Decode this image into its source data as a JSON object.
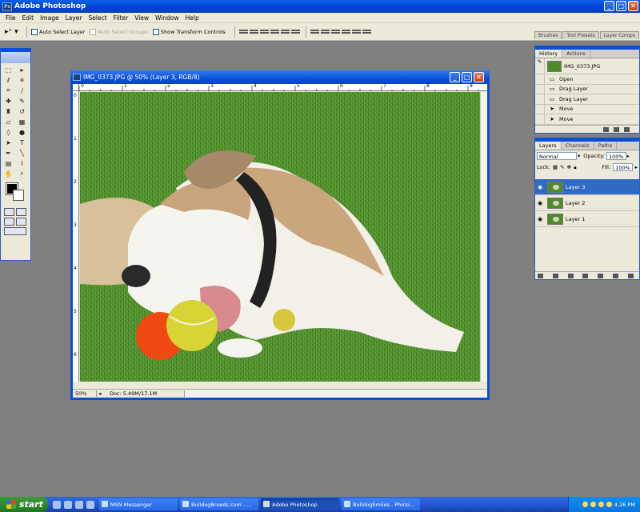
{
  "app": {
    "title": "Adobe Photoshop",
    "logo": "Ps",
    "min": "_",
    "max": "□",
    "close": "✕"
  },
  "menu": [
    "File",
    "Edit",
    "Image",
    "Layer",
    "Select",
    "Filter",
    "View",
    "Window",
    "Help"
  ],
  "options": {
    "auto_select_layer": "Auto Select Layer",
    "auto_select_groups": "Auto Select Groups",
    "show_transform_controls": "Show Transform Controls"
  },
  "palette_well": [
    "Brushes",
    "Tool Presets",
    "Layer Comps"
  ],
  "document": {
    "title": "IMG_0373.JPG @ 50% (Layer 3, RGB/8)",
    "zoom": "50%",
    "doc_info": "Doc: 5.49M/17.1M",
    "ruler_top": [
      "0",
      "1",
      "2",
      "3",
      "4",
      "5",
      "6",
      "7",
      "8",
      "9"
    ],
    "ruler_left": [
      "0",
      "1",
      "2",
      "3",
      "4",
      "5",
      "6"
    ]
  },
  "history": {
    "tabs": [
      "History",
      "Actions"
    ],
    "snapshot": "IMG_0373.JPG",
    "states": [
      "Open",
      "Drag Layer",
      "Drag Layer",
      "Move",
      "Move"
    ]
  },
  "layers": {
    "tabs": [
      "Layers",
      "Channels",
      "Paths"
    ],
    "blend_mode": "Normal",
    "opacity_label": "Opacity:",
    "opacity": "100%",
    "lock_label": "Lock:",
    "fill_label": "Fill:",
    "fill": "100%",
    "items": [
      {
        "name": "Layer 3",
        "selected": true
      },
      {
        "name": "Layer 2",
        "selected": false
      },
      {
        "name": "Layer 1",
        "selected": false
      }
    ]
  },
  "taskbar": {
    "start": "start",
    "buttons": [
      "MSN Messenger",
      "BulldogBreeds.com - ...",
      "Adobe Photoshop",
      "BulldogSmiles - Photo..."
    ],
    "clock": "4:26 PM"
  },
  "colors": {
    "accent": "#0a4fd8",
    "selected_layer": "#316ac5",
    "grass": "#4e8c2c"
  }
}
